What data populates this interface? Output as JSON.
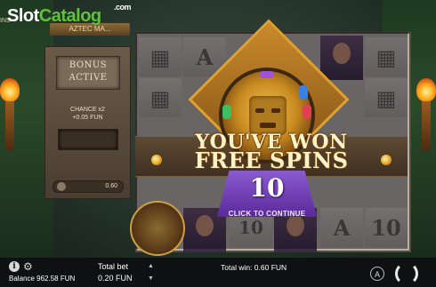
{
  "branding": {
    "logo_slot": "Slot",
    "logo_catalog": "Catalog",
    "logo_com": ".com",
    "partial_left_text": "INS",
    "game_title": "AZTEC MA..."
  },
  "side_panel": {
    "bonus_line1": "BONUS",
    "bonus_line2": "ACTIVE",
    "chance_line1": "CHANCE x2",
    "chance_line2": "+0.05 FUN",
    "bet_value": "0.60"
  },
  "win_popup": {
    "line1": "YOU'VE WON",
    "line2": "FREE SPINS",
    "spins_count": "10",
    "continue_label": "CLICK TO CONTINUE"
  },
  "reel_symbols": [
    "A",
    "10",
    "A",
    "10"
  ],
  "bottom_bar": {
    "info_label": "i",
    "gear_glyph": "⚙",
    "balance": "Balance 962.58 FUN",
    "total_bet_label": "Total bet",
    "total_bet_value": "0.20 FUN",
    "total_win": "Total win: 0.60 FUN",
    "auto_label": "A",
    "arrow_up": "▲",
    "arrow_down": "▼"
  },
  "colors": {
    "accent_green": "#5fc23a",
    "gold": "#e0a030",
    "purple": "#7a4ac0"
  }
}
